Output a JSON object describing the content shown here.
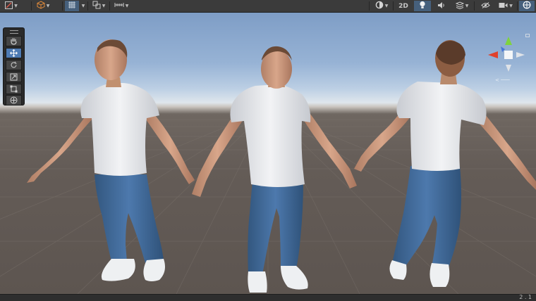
{
  "toolbar": {
    "left_tools": [
      {
        "icon": "gizmo-draw-icon"
      },
      {
        "icon": "cube-icon"
      },
      {
        "icon": "grid-snap-icon"
      },
      {
        "icon": "snap-increment-icon"
      },
      {
        "icon": "ruler-icon"
      }
    ],
    "right_tools": [
      {
        "icon": "shading-mode-icon"
      },
      {
        "icon": "lighting-icon"
      },
      {
        "icon": "audio-icon"
      },
      {
        "icon": "effects-icon"
      },
      {
        "icon": "visibility-icon"
      },
      {
        "icon": "camera-icon"
      },
      {
        "icon": "gizmos-icon"
      }
    ],
    "mode_2d_label": "2D",
    "lighting_active": true
  },
  "tools_palette": {
    "items": [
      {
        "name": "hand-tool",
        "icon": "hand-icon"
      },
      {
        "name": "move-tool",
        "icon": "move-arrows-icon",
        "active": true
      },
      {
        "name": "rotate-tool",
        "icon": "rotate-icon"
      },
      {
        "name": "scale-tool",
        "icon": "scale-icon"
      },
      {
        "name": "rect-tool",
        "icon": "rect-transform-icon"
      },
      {
        "name": "transform-tool",
        "icon": "transform-icon"
      }
    ]
  },
  "gizmo": {
    "axes": [
      {
        "axis": "y",
        "color": "#7fd33e"
      },
      {
        "axis": "x",
        "color": "#e0412b"
      },
      {
        "axis": "z",
        "color": "#3f6fd8"
      }
    ],
    "projection_icon": "perspective-icon"
  },
  "scene": {
    "characters": [
      {
        "name": "character-front-left",
        "view": "three-quarter"
      },
      {
        "name": "character-front",
        "view": "front"
      },
      {
        "name": "character-back",
        "view": "back"
      }
    ],
    "colors": {
      "skin": "#c9977c",
      "shirt": "#e9ebee",
      "jeans": "#3e6594",
      "sneakers": "#f1f1f1",
      "hair": "#5a3b2a"
    }
  },
  "status": {
    "text": "2 . 1"
  }
}
